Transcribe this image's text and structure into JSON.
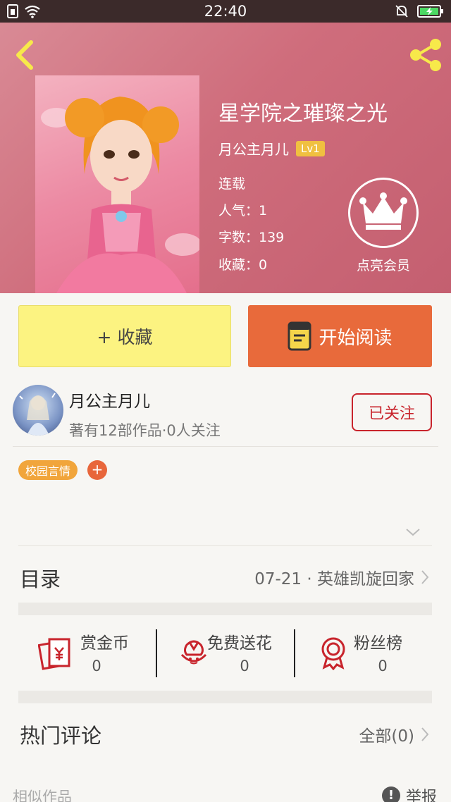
{
  "status_bar": {
    "time": "22:40"
  },
  "book": {
    "title": "星学院之璀璨之光",
    "author": "月公主月儿",
    "level": "Lv1",
    "status": "连载",
    "popularity": "人气：1",
    "word_count": "字数：139",
    "favorites": "收藏：0"
  },
  "vip": {
    "label": "点亮会员"
  },
  "actions": {
    "collect_label": "+ 收藏",
    "read_label": "开始阅读"
  },
  "author_card": {
    "name": "月公主月儿",
    "stats": "著有12部作品·0人关注",
    "follow_label": "已关注"
  },
  "tags": {
    "items": [
      "校园言情"
    ],
    "add_label": "+"
  },
  "catalog": {
    "title": "目录",
    "latest": "07-21 · 英雄凯旋回家"
  },
  "rewards": [
    {
      "label": "赏金币",
      "count": "0"
    },
    {
      "label": "免费送花",
      "count": "0"
    },
    {
      "label": "粉丝榜",
      "count": "0"
    }
  ],
  "comments": {
    "title": "热门评论",
    "all_label": "全部(0)"
  },
  "footer": {
    "similar_label": "相似作品",
    "report_label": "举报",
    "report_icon_glyph": "!"
  },
  "colors": {
    "accent_orange": "#e86a3b",
    "collect_yellow": "#fcf381",
    "follow_red": "#c8242c",
    "icon_red": "#c8242c"
  }
}
